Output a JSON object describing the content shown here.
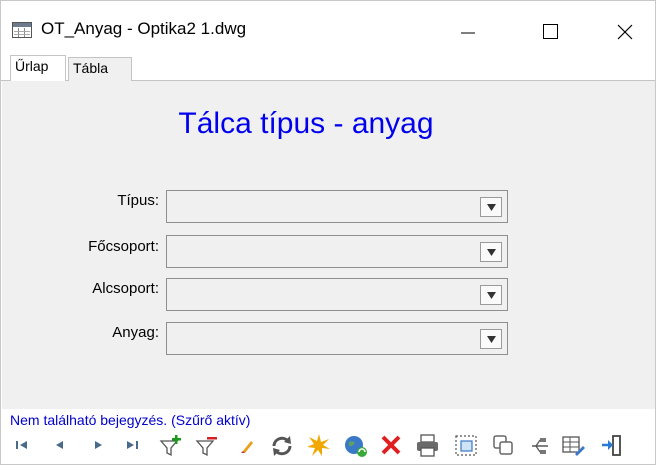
{
  "window": {
    "title": "OT_Anyag - Optika2 1.dwg",
    "controls": [
      "minimize",
      "maximize",
      "close"
    ]
  },
  "tabs": [
    {
      "label": "Űrlap",
      "active": true
    },
    {
      "label": "Tábla",
      "active": false
    }
  ],
  "form": {
    "heading": "Tálca típus - anyag",
    "fields": [
      {
        "label": "Típus:",
        "value": ""
      },
      {
        "label": "Főcsoport:",
        "value": ""
      },
      {
        "label": "Alcsoport:",
        "value": ""
      },
      {
        "label": "Anyag:",
        "value": ""
      }
    ]
  },
  "status": {
    "message": "Nem található bejegyzés. (Szűrő aktív)"
  },
  "toolbar": {
    "buttons": [
      "first-record-icon",
      "previous-record-icon",
      "next-record-icon",
      "last-record-icon",
      "add-filter-icon",
      "remove-filter-icon",
      "edit-pencil-icon",
      "refresh-icon",
      "new-record-star-icon",
      "globe-sync-icon",
      "delete-x-icon",
      "print-icon",
      "select-frame-icon",
      "copy-icon",
      "link-icon",
      "table-edit-icon",
      "exit-icon"
    ]
  },
  "colors": {
    "heading": "#0000ee",
    "status": "#0000cc",
    "form_background": "#f0f0f0"
  }
}
